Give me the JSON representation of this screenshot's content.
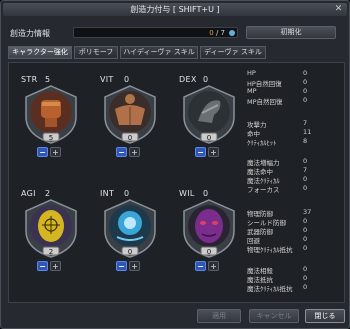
{
  "window": {
    "title": "創造力付与 [ SHIFT+U ]",
    "close_glyph": "✕"
  },
  "info": {
    "label": "創造力情報",
    "points_current": "0",
    "points_sep": " / ",
    "points_total": "7",
    "init_button": "初期化"
  },
  "tabs": [
    {
      "label": "キャラクター強化",
      "active": true
    },
    {
      "label": "ポリモーフ",
      "active": false
    },
    {
      "label": "ハイディーヴァ スキル",
      "active": false
    },
    {
      "label": "ディーヴァ スキル",
      "active": false
    }
  ],
  "attributes": [
    {
      "name": "STR",
      "value": "5",
      "level": "5",
      "icon": "fist-icon"
    },
    {
      "name": "VIT",
      "value": "0",
      "level": "0",
      "icon": "muscle-torso-icon"
    },
    {
      "name": "DEX",
      "value": "0",
      "level": "0",
      "icon": "running-foot-icon"
    },
    {
      "name": "AGI",
      "value": "2",
      "level": "2",
      "icon": "target-mask-icon"
    },
    {
      "name": "INT",
      "value": "0",
      "level": "0",
      "icon": "glowing-head-icon"
    },
    {
      "name": "WIL",
      "value": "0",
      "level": "0",
      "icon": "purple-mask-icon"
    }
  ],
  "buttons": {
    "minus": "−",
    "plus": "+"
  },
  "stats": [
    {
      "label": "HP",
      "value": "0"
    },
    {
      "label": "HP自然回復",
      "value": "0"
    },
    {
      "label": "MP",
      "value": "0"
    },
    {
      "label": "MP自然回復",
      "value": "0"
    },
    {
      "label": "攻撃力",
      "value": "7"
    },
    {
      "label": "命中",
      "value": "11"
    },
    {
      "label": "ｸﾘﾃｨｶﾙﾋｯﾄ",
      "value": "8"
    },
    {
      "label": "魔法増幅力",
      "value": "0"
    },
    {
      "label": "魔法命中",
      "value": "7"
    },
    {
      "label": "魔法ｸﾘﾃｨｶﾙ",
      "value": "0"
    },
    {
      "label": "フォーカス",
      "value": "0"
    },
    {
      "label": "物理防御",
      "value": "37"
    },
    {
      "label": "シールド防御",
      "value": "0"
    },
    {
      "label": "武器防御",
      "value": "0"
    },
    {
      "label": "回避",
      "value": "0"
    },
    {
      "label": "物理ｸﾘﾃｨｶﾙ抵抗",
      "value": "0"
    },
    {
      "label": "魔法相殺",
      "value": "0"
    },
    {
      "label": "魔法抵抗",
      "value": "0"
    },
    {
      "label": "魔法ｸﾘﾃｨｶﾙ抵抗",
      "value": "0"
    }
  ],
  "footer": {
    "apply": "適用",
    "cancel": "キャンセル",
    "close": "閉じる"
  }
}
